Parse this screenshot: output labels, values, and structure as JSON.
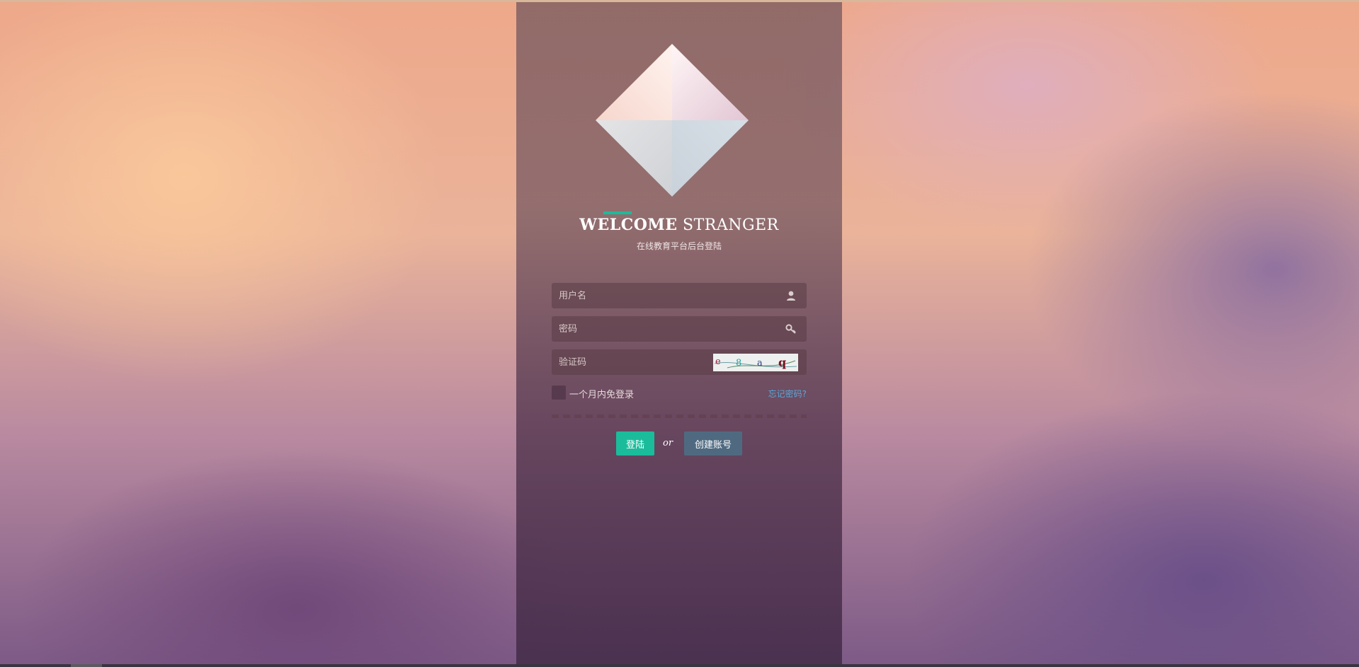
{
  "welcome": {
    "bold_word": "WELCOME",
    "thin_word": "STRANGER",
    "subtitle": "在线教育平台后台登陆"
  },
  "form": {
    "username_placeholder": "用户名",
    "password_placeholder": "密码",
    "captcha_placeholder": "验证码",
    "captcha_text": "e 8 a q",
    "remember_label": "一个月内免登录",
    "forgot_label": "忘记密码?"
  },
  "actions": {
    "login_label": "登陆",
    "or_label": "or",
    "create_label": "创建账号"
  },
  "icons": {
    "username": "user-icon",
    "password": "key-icon"
  },
  "colors": {
    "accent": "#1bbc9b",
    "create_button": "#4f6a80",
    "link": "#5aa7d8"
  }
}
